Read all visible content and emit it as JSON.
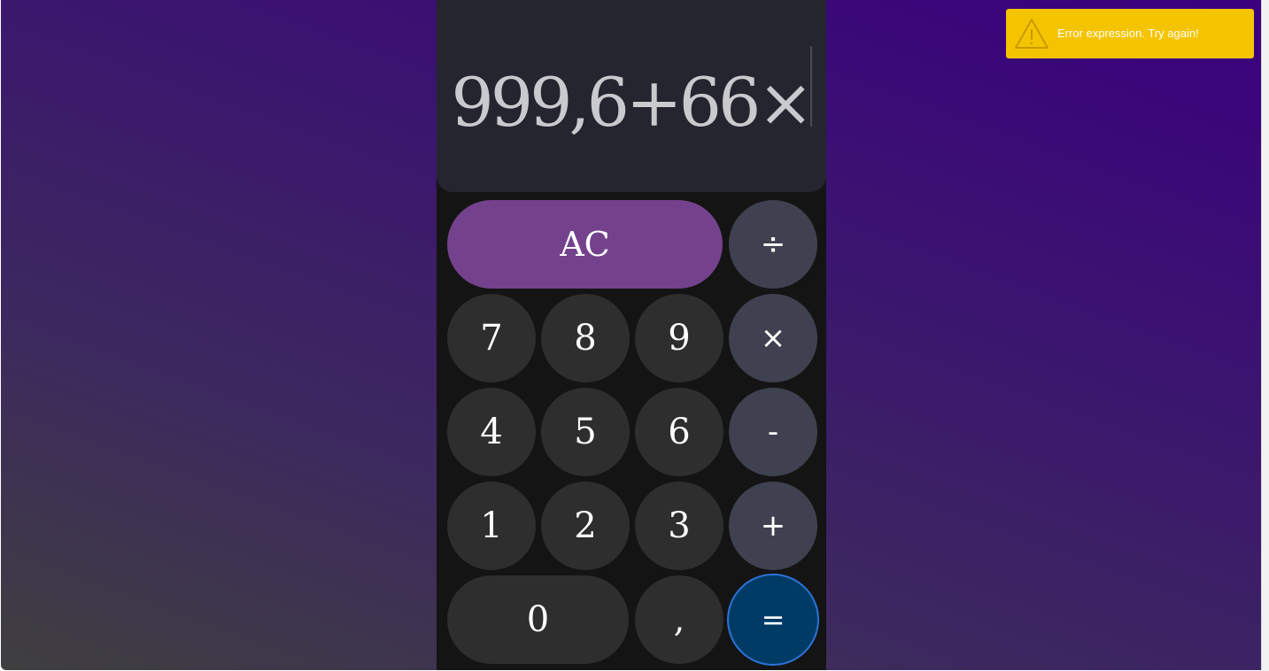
{
  "display": {
    "expression": "999,6+66×"
  },
  "keys": {
    "ac": "AC",
    "divide": "÷",
    "seven": "7",
    "eight": "8",
    "nine": "9",
    "multiply": "×",
    "four": "4",
    "five": "5",
    "six": "6",
    "minus": "-",
    "one": "1",
    "two": "2",
    "three": "3",
    "plus": "+",
    "zero": "0",
    "comma": ",",
    "equals": "="
  },
  "toast": {
    "message": "Error expression. Try again!",
    "icon": "warning-icon"
  },
  "colors": {
    "toast_background": "#f5c400",
    "ac_key": "#74428d",
    "operator_key": "#3f4150",
    "digit_key": "#2e2e2e",
    "equals_key": "#003b66",
    "equals_border": "#2b73d8"
  }
}
